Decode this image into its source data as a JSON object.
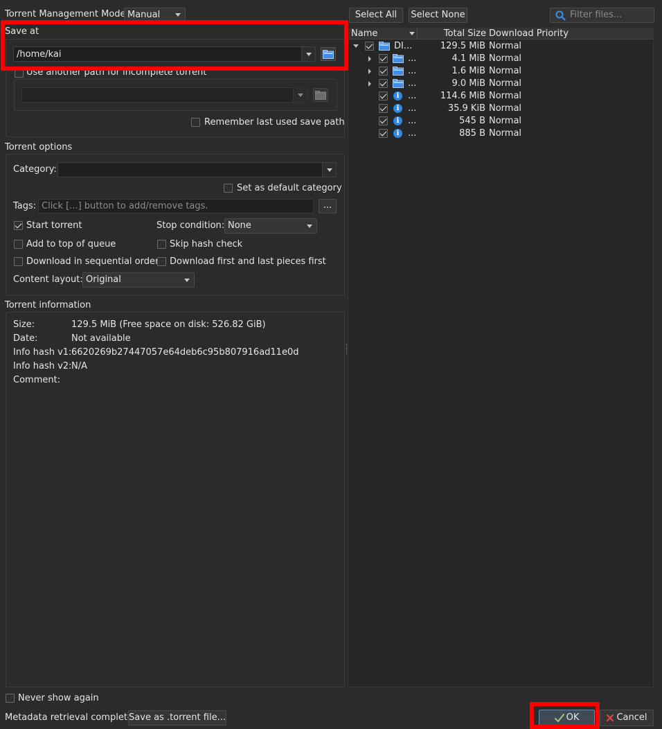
{
  "torrent_management": {
    "label": "Torrent Management Mode:",
    "value": "Manual"
  },
  "save_at": {
    "title": "Save at",
    "path": "/home/kai",
    "incomplete_label": "Use another path for incomplete torrent",
    "remember_label": "Remember last used save path"
  },
  "torrent_options": {
    "title": "Torrent options",
    "category_label": "Category:",
    "set_default_label": "Set as default category",
    "tags_label": "Tags:",
    "tags_placeholder": "Click [...] button to add/remove tags.",
    "tags_button": "...",
    "start_torrent": "Start torrent",
    "stop_condition_label": "Stop condition:",
    "stop_condition_value": "None",
    "add_top_queue": "Add to top of queue",
    "skip_hash": "Skip hash check",
    "sequential": "Download in sequential order",
    "first_last": "Download first and last pieces first",
    "content_layout_label": "Content layout:",
    "content_layout_value": "Original"
  },
  "torrent_info": {
    "title": "Torrent information",
    "rows": [
      {
        "label": "Size:",
        "value": "129.5 MiB (Free space on disk: 526.82 GiB)"
      },
      {
        "label": "Date:",
        "value": "Not available"
      },
      {
        "label": "Info hash v1:",
        "value": "6620269b27447057e64deb6c95b807916ad11e0d"
      },
      {
        "label": "Info hash v2:",
        "value": "N/A"
      },
      {
        "label": "Comment:",
        "value": ""
      }
    ]
  },
  "file_toolbar": {
    "select_all": "Select All",
    "select_none": "Select None",
    "filter_placeholder": "Filter files..."
  },
  "tree": {
    "headers": {
      "name": "Name",
      "size": "Total Size",
      "priority": "Download Priority"
    },
    "rows": [
      {
        "name": "DI...",
        "size": "129.5 MiB",
        "priority": "Normal",
        "icon": "folder-icon"
      },
      {
        "name": "...",
        "size": "4.1 MiB",
        "priority": "Normal",
        "icon": "folder-icon"
      },
      {
        "name": "...",
        "size": "1.6 MiB",
        "priority": "Normal",
        "icon": "folder-icon"
      },
      {
        "name": "...",
        "size": "9.0 MiB",
        "priority": "Normal",
        "icon": "folder-icon"
      },
      {
        "name": "...",
        "size": "114.6 MiB",
        "priority": "Normal",
        "icon": "info-icon"
      },
      {
        "name": "...",
        "size": "35.9 KiB",
        "priority": "Normal",
        "icon": "info-icon"
      },
      {
        "name": "...",
        "size": "545 B",
        "priority": "Normal",
        "icon": "info-icon"
      },
      {
        "name": "...",
        "size": "885 B",
        "priority": "Normal",
        "icon": "info-icon"
      }
    ]
  },
  "footer": {
    "never_show": "Never show again",
    "status": "Metadata retrieval complete",
    "save_torrent_file": "Save as .torrent file...",
    "ok": "OK",
    "cancel": "Cancel"
  },
  "colors": {
    "highlight": "#ff0000",
    "accent": "#2f8ae0",
    "background": "#2b2b2b"
  }
}
